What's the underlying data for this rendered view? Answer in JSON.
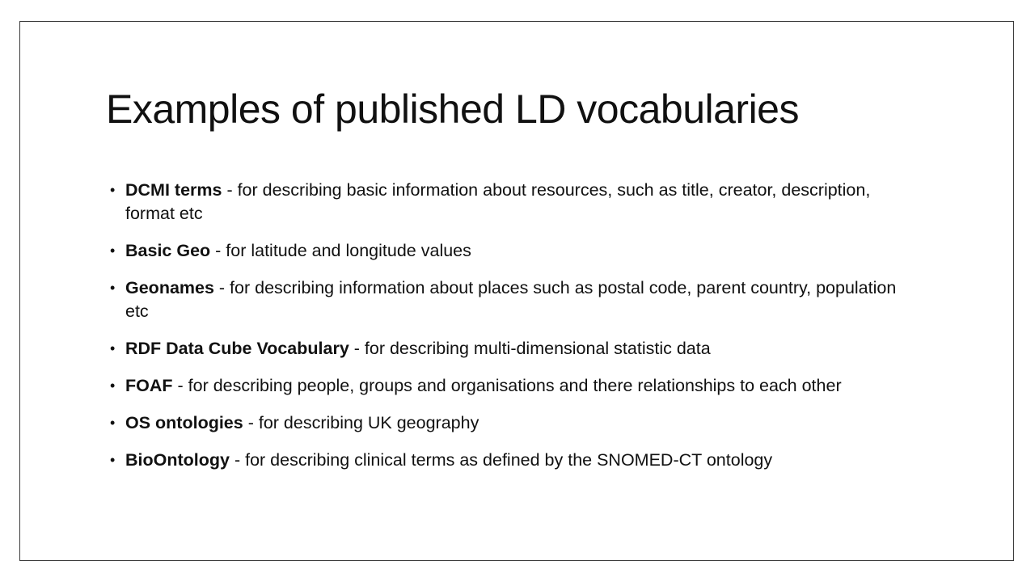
{
  "slide": {
    "title": "Examples of published LD vocabularies",
    "bullets": [
      {
        "term": "DCMI terms",
        "text": " - for describing basic information about resources, such as title, creator, description, format etc"
      },
      {
        "term": "Basic Geo",
        "text": " - for latitude and longitude values"
      },
      {
        "term": "Geonames",
        "text": " - for describing information about places such as postal code, parent country, population etc"
      },
      {
        "term": "RDF Data Cube Vocabulary",
        "text": " - for describing multi-dimensional statistic data"
      },
      {
        "term": "FOAF",
        "text": " - for describing people, groups and organisations and there relationships to each other"
      },
      {
        "term": "OS ontologies",
        "text": " - for describing UK geography"
      },
      {
        "term": "BioOntology",
        "text": " - for describing clinical terms as defined by the SNOMED-CT ontology"
      }
    ]
  }
}
